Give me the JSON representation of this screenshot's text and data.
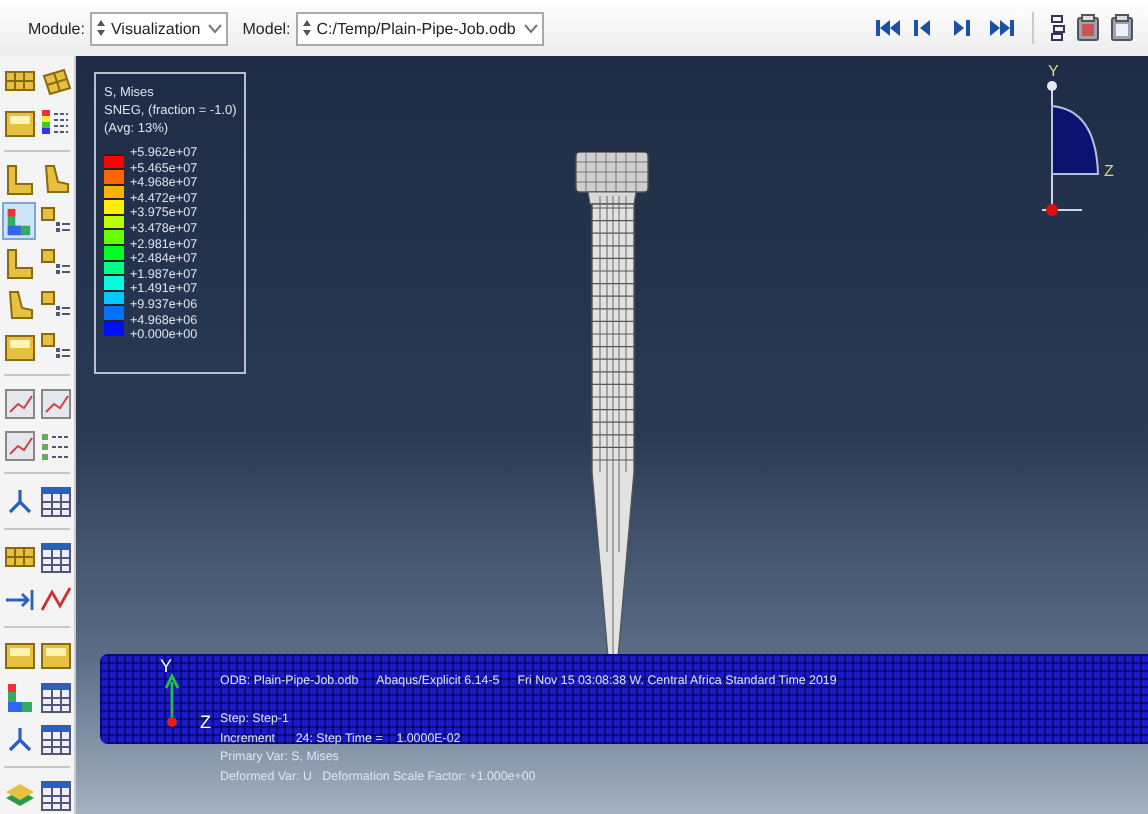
{
  "toolbar": {
    "module": {
      "label": "Module:",
      "value": "Visualization"
    },
    "model": {
      "label": "Model:",
      "value": "C:/Temp/Plain-Pipe-Job.odb"
    }
  },
  "toolbox": {
    "groups": [
      {
        "rows": [
          [
            {
              "kind": "grid",
              "selected": false
            },
            {
              "kind": "grid2",
              "selected": false
            }
          ],
          [
            {
              "kind": "sheet",
              "selected": false
            },
            {
              "kind": "legend",
              "selected": false
            }
          ]
        ]
      },
      {
        "rows": [
          [
            {
              "kind": "lshape",
              "selected": false
            },
            {
              "kind": "lshape2",
              "selected": false
            }
          ],
          [
            {
              "kind": "contour",
              "selected": true
            },
            {
              "kind": "options",
              "selected": false
            }
          ],
          [
            {
              "kind": "lshape",
              "selected": false
            },
            {
              "kind": "options",
              "selected": false
            }
          ],
          [
            {
              "kind": "lshape2",
              "selected": false
            },
            {
              "kind": "options",
              "selected": false
            }
          ],
          [
            {
              "kind": "sheet",
              "selected": false
            },
            {
              "kind": "options",
              "selected": false
            }
          ]
        ]
      },
      {
        "rows": [
          [
            {
              "kind": "plot",
              "selected": false
            },
            {
              "kind": "plot",
              "selected": false
            }
          ],
          [
            {
              "kind": "plot",
              "selected": false
            },
            {
              "kind": "list",
              "selected": false
            }
          ]
        ]
      },
      {
        "rows": [
          [
            {
              "kind": "tree",
              "selected": false
            },
            {
              "kind": "table",
              "selected": false
            }
          ]
        ]
      },
      {
        "rows": [
          [
            {
              "kind": "grid",
              "selected": false
            },
            {
              "kind": "table",
              "selected": false
            }
          ],
          [
            {
              "kind": "arrow",
              "selected": false
            },
            {
              "kind": "path",
              "selected": false
            }
          ]
        ]
      },
      {
        "rows": [
          [
            {
              "kind": "sheet",
              "selected": false
            },
            {
              "kind": "sheet",
              "selected": false
            }
          ],
          [
            {
              "kind": "contour",
              "selected": false
            },
            {
              "kind": "table",
              "selected": false
            }
          ],
          [
            {
              "kind": "tree",
              "selected": false
            },
            {
              "kind": "table",
              "selected": false
            }
          ]
        ]
      },
      {
        "rows": [
          [
            {
              "kind": "layers",
              "selected": false
            },
            {
              "kind": "table",
              "selected": false
            }
          ]
        ]
      }
    ]
  },
  "legend": {
    "title": [
      "S, Mises",
      "SNEG, (fraction = -1.0)",
      "(Avg: 13%)"
    ],
    "values": [
      "+5.962e+07",
      "+5.465e+07",
      "+4.968e+07",
      "+4.472e+07",
      "+3.975e+07",
      "+3.478e+07",
      "+2.981e+07",
      "+2.484e+07",
      "+1.987e+07",
      "+1.491e+07",
      "+9.937e+06",
      "+4.968e+06",
      "+0.000e+00"
    ],
    "bands": [
      {
        "color": "#ff0000"
      },
      {
        "color": "#ff6600"
      },
      {
        "color": "#ffb300"
      },
      {
        "color": "#ffee00"
      },
      {
        "color": "#b8ff00"
      },
      {
        "color": "#66ff00"
      },
      {
        "color": "#00ff22"
      },
      {
        "color": "#00ff88"
      },
      {
        "color": "#00ffdd"
      },
      {
        "color": "#00c8ff"
      },
      {
        "color": "#0070ff"
      },
      {
        "color": "#0010ff"
      }
    ]
  },
  "orientation_triad": {
    "y_label": "Y",
    "z_label": "Z"
  },
  "view_triad": {
    "y_label": "Y",
    "z_label": "Z"
  },
  "info": {
    "header": [
      "ODB: Plain-Pipe-Job.odb",
      "Abaqus/Explicit 6.14-5",
      "Fri Nov 15 03:08:38 W. Central Africa Standard Time 2019"
    ],
    "lines": [
      "Step: Step-1",
      "Increment      24: Step Time =    1.0000E-02",
      "Primary Var: S, Mises",
      "Deformed Var: U   Deformation Scale Factor: +1.000e+00"
    ]
  }
}
